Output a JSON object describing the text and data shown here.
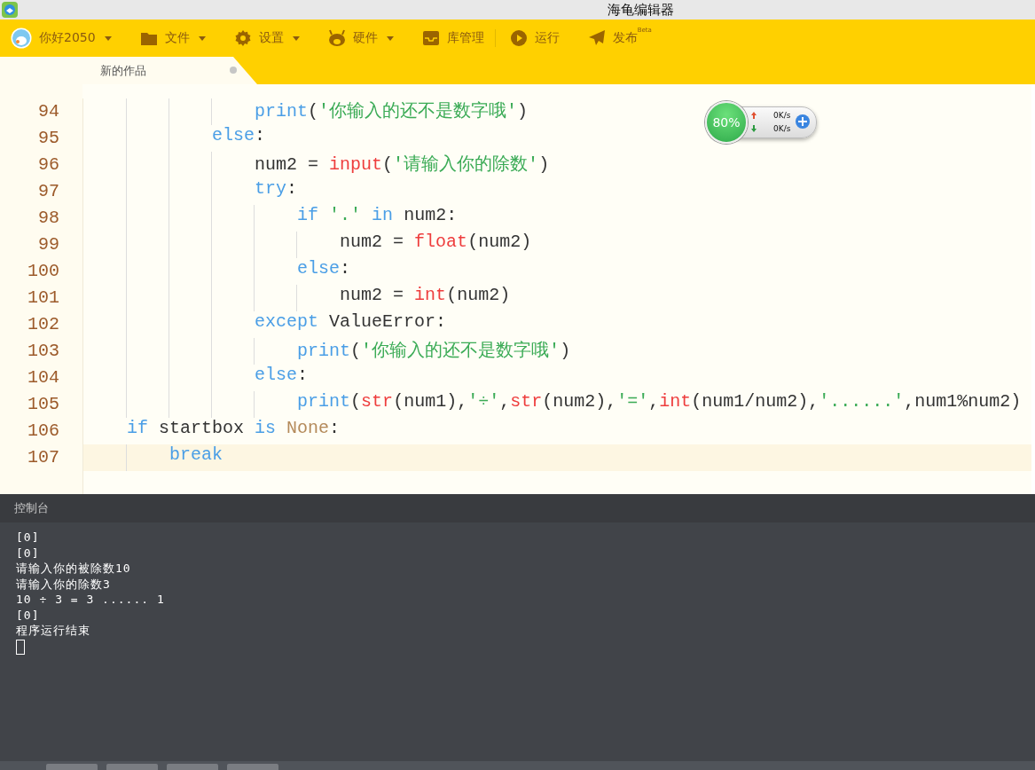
{
  "window": {
    "title": "海龟编辑器"
  },
  "toolbar": {
    "items": [
      {
        "label": "你好2050",
        "dropdown": true
      },
      {
        "label": "文件",
        "dropdown": true
      },
      {
        "label": "设置",
        "dropdown": true
      },
      {
        "label": "硬件",
        "dropdown": true
      },
      {
        "label": "库管理",
        "dropdown": false
      },
      {
        "label": "运行",
        "dropdown": false
      },
      {
        "label": "发布",
        "badge": "Beta",
        "dropdown": false
      }
    ]
  },
  "tabs": [
    {
      "label": "新的作品",
      "selected": true,
      "unsaved": true
    }
  ],
  "editor": {
    "lines": [
      {
        "number": "94",
        "current": false,
        "tokens": [
          {
            "kind": "keyword",
            "text": "                print"
          },
          {
            "kind": "plain",
            "text": "("
          },
          {
            "kind": "string",
            "text": "'你输入的还不是数字哦'"
          },
          {
            "kind": "plain",
            "text": ")"
          }
        ]
      },
      {
        "number": "95",
        "current": false,
        "tokens": [
          {
            "kind": "keyword",
            "text": "            else"
          },
          {
            "kind": "plain",
            "text": ":"
          }
        ]
      },
      {
        "number": "96",
        "current": false,
        "tokens": [
          {
            "kind": "plain",
            "text": "                num2 = "
          },
          {
            "kind": "builtin",
            "text": "input"
          },
          {
            "kind": "plain",
            "text": "("
          },
          {
            "kind": "string",
            "text": "'请输入你的除数'"
          },
          {
            "kind": "plain",
            "text": ")"
          }
        ]
      },
      {
        "number": "97",
        "current": false,
        "tokens": [
          {
            "kind": "keyword",
            "text": "                try"
          },
          {
            "kind": "plain",
            "text": ":"
          }
        ]
      },
      {
        "number": "98",
        "current": false,
        "tokens": [
          {
            "kind": "keyword",
            "text": "                    if"
          },
          {
            "kind": "string",
            "text": " '.'"
          },
          {
            "kind": "keyword",
            "text": " in"
          },
          {
            "kind": "plain",
            "text": " num2:"
          }
        ]
      },
      {
        "number": "99",
        "current": false,
        "tokens": [
          {
            "kind": "plain",
            "text": "                        num2 = "
          },
          {
            "kind": "builtin",
            "text": "float"
          },
          {
            "kind": "plain",
            "text": "(num2)"
          }
        ]
      },
      {
        "number": "100",
        "current": false,
        "tokens": [
          {
            "kind": "keyword",
            "text": "                    else"
          },
          {
            "kind": "plain",
            "text": ":"
          }
        ]
      },
      {
        "number": "101",
        "current": false,
        "tokens": [
          {
            "kind": "plain",
            "text": "                        num2 = "
          },
          {
            "kind": "builtin",
            "text": "int"
          },
          {
            "kind": "plain",
            "text": "(num2)"
          }
        ]
      },
      {
        "number": "102",
        "current": false,
        "tokens": [
          {
            "kind": "keyword",
            "text": "                except"
          },
          {
            "kind": "plain",
            "text": " ValueError:"
          }
        ]
      },
      {
        "number": "103",
        "current": false,
        "tokens": [
          {
            "kind": "keyword",
            "text": "                    print"
          },
          {
            "kind": "plain",
            "text": "("
          },
          {
            "kind": "string",
            "text": "'你输入的还不是数字哦'"
          },
          {
            "kind": "plain",
            "text": ")"
          }
        ]
      },
      {
        "number": "104",
        "current": false,
        "tokens": [
          {
            "kind": "keyword",
            "text": "                else"
          },
          {
            "kind": "plain",
            "text": ":"
          }
        ]
      },
      {
        "number": "105",
        "current": false,
        "tokens": [
          {
            "kind": "keyword",
            "text": "                    print"
          },
          {
            "kind": "plain",
            "text": "("
          },
          {
            "kind": "builtin",
            "text": "str"
          },
          {
            "kind": "plain",
            "text": "(num1),"
          },
          {
            "kind": "string",
            "text": "'÷'"
          },
          {
            "kind": "plain",
            "text": ","
          },
          {
            "kind": "builtin",
            "text": "str"
          },
          {
            "kind": "plain",
            "text": "(num2),"
          },
          {
            "kind": "string",
            "text": "'='"
          },
          {
            "kind": "plain",
            "text": ","
          },
          {
            "kind": "builtin",
            "text": "int"
          },
          {
            "kind": "plain",
            "text": "(num1/num2),"
          },
          {
            "kind": "string",
            "text": "'......'"
          },
          {
            "kind": "plain",
            "text": ",num1%num2)"
          }
        ]
      },
      {
        "number": "106",
        "current": false,
        "tokens": [
          {
            "kind": "keyword",
            "text": "    if"
          },
          {
            "kind": "plain",
            "text": " startbox "
          },
          {
            "kind": "keyword",
            "text": "is"
          },
          {
            "kind": "constant",
            "text": " None"
          },
          {
            "kind": "plain",
            "text": ":"
          }
        ]
      },
      {
        "number": "107",
        "current": true,
        "tokens": [
          {
            "kind": "keyword",
            "text": "        break"
          }
        ]
      }
    ]
  },
  "network_widget": {
    "percent": "80%",
    "upload": "0K/s",
    "download": "0K/s"
  },
  "console": {
    "title": "控制台",
    "lines": [
      "[0]",
      "[0]",
      "请输入你的被除数10",
      "请输入你的除数3",
      "10 ÷ 3 = 3 ...... 1",
      "[0]",
      "程序运行结束"
    ],
    "cursor": true
  }
}
